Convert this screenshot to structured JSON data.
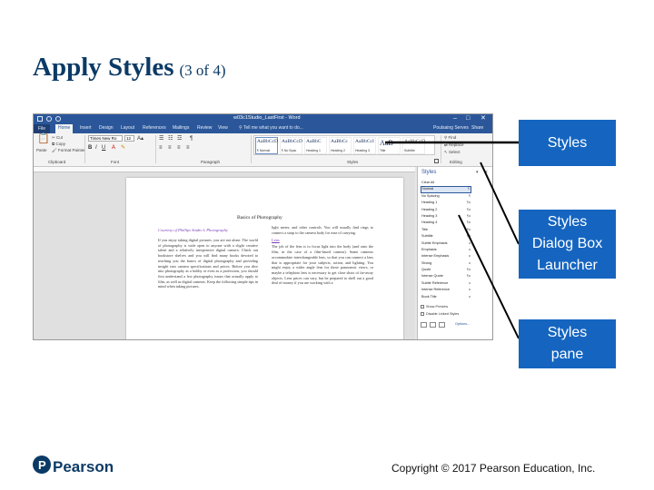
{
  "slide": {
    "title": "Apply Styles",
    "title_suffix": "(3 of 4)",
    "copyright": "Copyright © 2017 Pearson Education, Inc.",
    "logo_text": "Pearson",
    "accent": "#1565c0",
    "title_color": "#0b3a66"
  },
  "callouts": [
    {
      "lines": [
        "Styles"
      ]
    },
    {
      "lines": [
        "Styles",
        "Dialog Box",
        "Launcher"
      ]
    },
    {
      "lines": [
        "Styles",
        "pane"
      ]
    }
  ],
  "word": {
    "window_title": "w03c1Studio_LastFirst - Word",
    "window_controls": [
      "–",
      "□",
      "✕"
    ],
    "tabs": [
      "File",
      "Home",
      "Insert",
      "Design",
      "Layout",
      "References",
      "Mailings",
      "Review",
      "View"
    ],
    "tell_me": "Tell me what you want to do...",
    "user": "Poulsaing Serves",
    "share": "Share",
    "ribbon": {
      "cut": "Cut",
      "copy": "Copy",
      "format_painter": "Format Painter",
      "paste": "Paste",
      "font_name": "Times New Ro",
      "font_size": "12",
      "groups": [
        "Clipboard",
        "Font",
        "Paragraph",
        "Styles",
        "Editing"
      ],
      "find": "Find",
      "replace": "Replace",
      "select": "Select",
      "styles_gallery": [
        {
          "sample": "AaBbCcD",
          "name": "¶ Normal"
        },
        {
          "sample": "AaBbCcD",
          "name": "¶ No Spac"
        },
        {
          "sample": "AaBbC",
          "name": "Heading 1"
        },
        {
          "sample": "AaBbCc",
          "name": "Heading 2"
        },
        {
          "sample": "AaBbCcI",
          "name": "Heading 3"
        },
        {
          "sample": "AaB",
          "name": "Title"
        },
        {
          "sample": "AaBbCcD",
          "name": "Subtitle"
        }
      ]
    },
    "document": {
      "heading": "Basics of Photography",
      "subtitle": "Courtesy of Phillips Studio L Photography",
      "left_text": "If you enjoy taking digital pictures, you are not alone. The world of photography is wide open to anyone with a slight creative talent and a relatively inexpensive digital camera. Check out bookstore shelves and you will find many books devoted to teaching you the basics of digital photography and providing insight into camera specifications and prices. Before you dive into photography as a hobby or even as a profession, you should first understand a few photography issues that actually apply to film, as well as digital cameras. Keep the following simple tips in mind when taking pictures.",
      "right_intro": "light meter, and other controls. You will usually find rings to connect a strap to the camera body for ease of carrying.",
      "lens_heading": "Lens",
      "right_text": "The job of the lens is to focus light into the body (and onto the film, in the case of a film-based camera). Some cameras accommodate interchangeable lens, so that you can connect a lens that is appropriate for your subjects, action, and lighting. You might enjoy a wider angle lens for those panoramic views, or maybe a telephoto lens is necessary to get close shots of far-away objects. Lens prices can vary, but be prepared to shell out a good deal of money if you are working with a"
    },
    "styles_pane": {
      "title": "Styles",
      "close": "✕",
      "pin": "▾",
      "items": [
        {
          "name": "Clear All",
          "mark": ""
        },
        {
          "name": "Normal",
          "mark": "¶"
        },
        {
          "name": "No Spacing",
          "mark": "¶"
        },
        {
          "name": "Heading 1",
          "mark": "¶a"
        },
        {
          "name": "Heading 2",
          "mark": "¶a"
        },
        {
          "name": "Heading 3",
          "mark": "¶a"
        },
        {
          "name": "Heading 4",
          "mark": "¶a"
        },
        {
          "name": "Title",
          "mark": "¶a"
        },
        {
          "name": "Subtitle",
          "mark": "¶a"
        },
        {
          "name": "Subtle Emphasis",
          "mark": "a"
        },
        {
          "name": "Emphasis",
          "mark": "a"
        },
        {
          "name": "Intense Emphasis",
          "mark": "a"
        },
        {
          "name": "Strong",
          "mark": "a"
        },
        {
          "name": "Quote",
          "mark": "¶a"
        },
        {
          "name": "Intense Quote",
          "mark": "¶a"
        },
        {
          "name": "Subtle Reference",
          "mark": "a"
        },
        {
          "name": "Intense Reference",
          "mark": "a"
        },
        {
          "name": "Book Title",
          "mark": "a"
        }
      ],
      "show_preview": "Show Preview",
      "disable_linked": "Disable Linked Styles",
      "options": "Options..."
    }
  }
}
